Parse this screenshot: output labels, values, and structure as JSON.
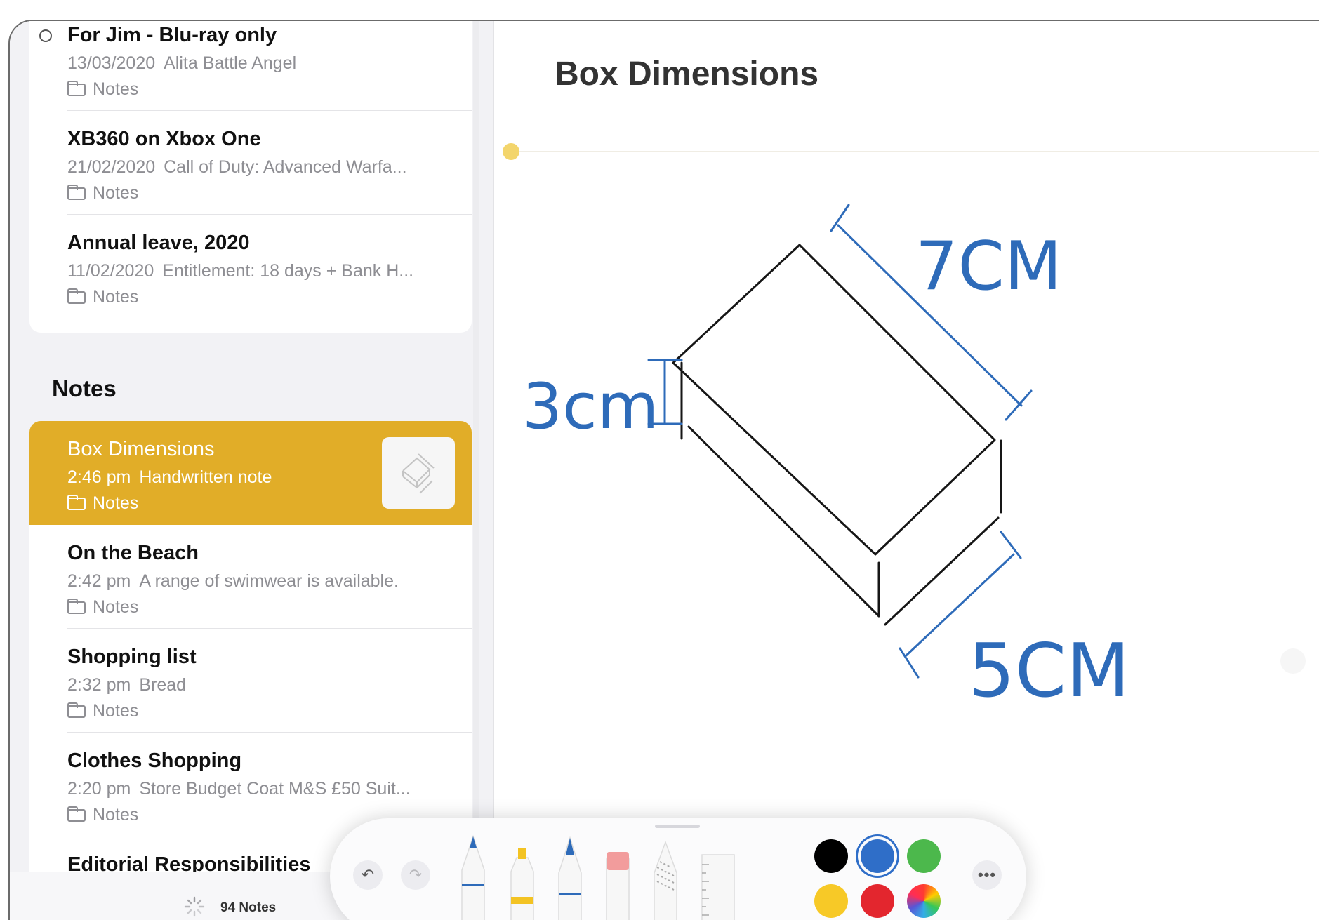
{
  "pinned_notes": [
    {
      "title": "For Jim - Blu-ray only",
      "date": "13/03/2020",
      "preview": "Alita Battle Angel",
      "folder": "Notes"
    },
    {
      "title": "XB360 on Xbox One",
      "date": "21/02/2020",
      "preview": "Call of Duty: Advanced Warfa...",
      "folder": "Notes"
    },
    {
      "title": "Annual leave, 2020",
      "date": "11/02/2020",
      "preview": "Entitlement: 18 days + Bank H...",
      "folder": "Notes"
    }
  ],
  "section_heading": "Notes",
  "notes": [
    {
      "title": "Box Dimensions",
      "date": "2:46 pm",
      "preview": "Handwritten note",
      "folder": "Notes"
    },
    {
      "title": "On the Beach",
      "date": "2:42 pm",
      "preview": "A range of swimwear is available.",
      "folder": "Notes"
    },
    {
      "title": "Shopping list",
      "date": "2:32 pm",
      "preview": "Bread",
      "folder": "Notes"
    },
    {
      "title": "Clothes Shopping",
      "date": "2:20 pm",
      "preview": "Store Budget Coat M&S £50 Suit...",
      "folder": "Notes"
    },
    {
      "title": "Editorial Responsibilities",
      "date": "",
      "preview": "",
      "folder": ""
    }
  ],
  "footer": {
    "count": "94 Notes"
  },
  "editor": {
    "title": "Box Dimensions",
    "labels": {
      "height": "3cm",
      "length": "7CM",
      "width": "5CM"
    }
  },
  "palette": {
    "icons": [
      "undo-icon",
      "redo-icon",
      "pen-tool",
      "marker-tool",
      "pencil-tool",
      "eraser-tool",
      "lasso-tool",
      "ruler-tool",
      "more-icon"
    ],
    "colors": [
      "#000000",
      "#2f6ec8",
      "#4cb84c",
      "#f7c927",
      "#e3262e",
      "color-wheel"
    ],
    "selected_color": "#2f6ec8"
  },
  "accent": "#e1ad28"
}
